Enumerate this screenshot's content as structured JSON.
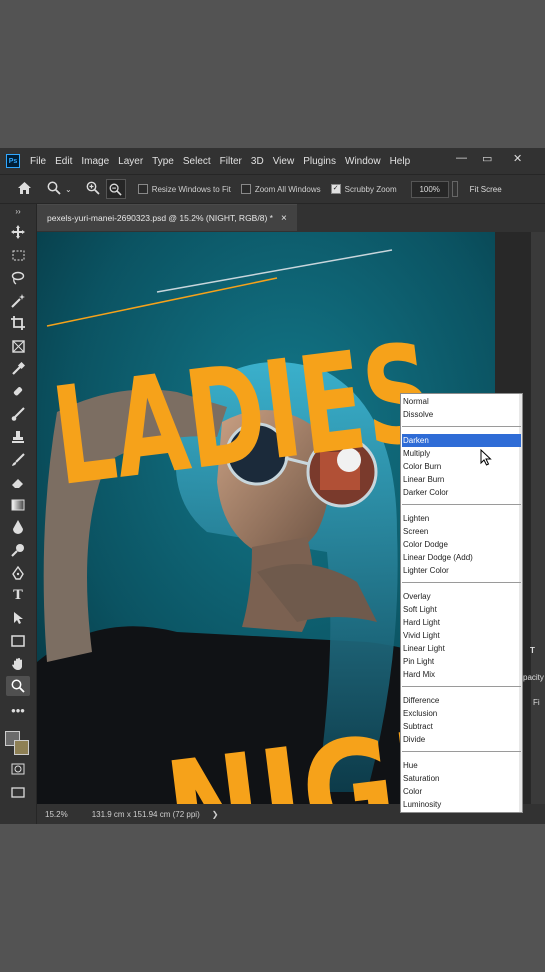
{
  "app": {
    "logo": "Ps",
    "menu": [
      "File",
      "Edit",
      "Image",
      "Layer",
      "Type",
      "Select",
      "Filter",
      "3D",
      "View",
      "Plugins",
      "Window",
      "Help"
    ],
    "window_controls": {
      "minimize": "—",
      "restore": "▭",
      "close": "✕"
    }
  },
  "options_bar": {
    "resize_windows": "Resize Windows to Fit",
    "zoom_all": "Zoom All Windows",
    "scrubby_zoom": "Scrubby Zoom",
    "scrubby_checked": true,
    "zoom_value": "100%",
    "fit_screen": "Fit Scree"
  },
  "document": {
    "tab_title": "pexels-yuri-manei-2690323.psd @ 15.2% (NIGHT, RGB/8) *",
    "tab_close": "×",
    "headline_1": "LADIES",
    "headline_2": "NIGHT"
  },
  "status": {
    "zoom": "15.2%",
    "dimensions": "131.9 cm x 151.94 cm (72 ppi)",
    "arrow": "❯"
  },
  "blend_modes": {
    "selected": "Darken",
    "groups": [
      [
        "Normal",
        "Dissolve"
      ],
      [
        "Darken",
        "Multiply",
        "Color Burn",
        "Linear Burn",
        "Darker Color"
      ],
      [
        "Lighten",
        "Screen",
        "Color Dodge",
        "Linear Dodge (Add)",
        "Lighter Color"
      ],
      [
        "Overlay",
        "Soft Light",
        "Hard Light",
        "Vivid Light",
        "Linear Light",
        "Pin Light",
        "Hard Mix"
      ],
      [
        "Difference",
        "Exclusion",
        "Subtract",
        "Divide"
      ],
      [
        "Hue",
        "Saturation",
        "Color",
        "Luminosity"
      ]
    ]
  },
  "side_panel_fragments": {
    "t": "T",
    "opacity": "pacity",
    "fi": "Fi"
  },
  "colors": {
    "text_accent": "#f6a21a",
    "teal_background": "#0e5d6d",
    "selection": "#2f6cd6"
  }
}
